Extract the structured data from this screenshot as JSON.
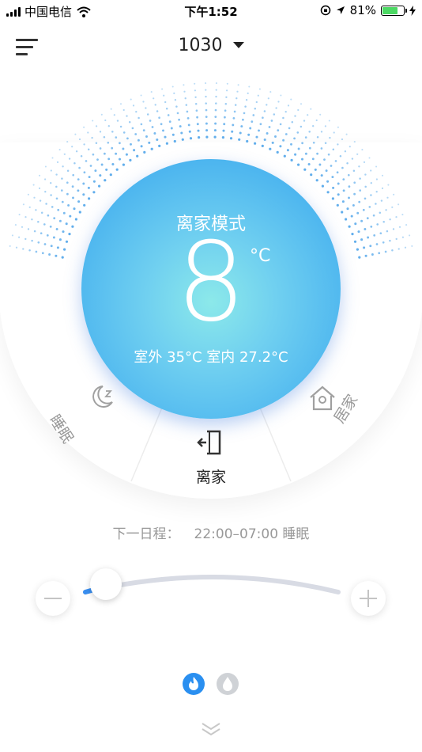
{
  "status_bar": {
    "carrier": "中国电信",
    "time": "下午1:52",
    "battery_percent": "81%",
    "battery_level": 0.81
  },
  "header": {
    "device_name": "1030"
  },
  "dial": {
    "mode_title": "离家模式",
    "temperature": "8",
    "unit": "°C",
    "outdoor_indoor": "室外 35°C 室内 27.2°C",
    "modes": {
      "sleep": "睡眠",
      "away": "离家",
      "home": "居家"
    }
  },
  "schedule": {
    "label": "下一日程：",
    "value": "22:00–07:00 睡眠"
  },
  "slider": {
    "level": 0.03
  },
  "colors": {
    "accent": "#2a8ff0",
    "dial_top": "#3a9ff0",
    "dial_center": "#8ce9ea",
    "muted": "#9a9a9a"
  },
  "icons": {
    "menu": "menu-icon",
    "sleep": "moon-icon",
    "away": "exit-door-icon",
    "home": "house-icon",
    "heat": "flame-icon",
    "water": "drop-icon",
    "expand": "chevron-down-double-icon"
  }
}
